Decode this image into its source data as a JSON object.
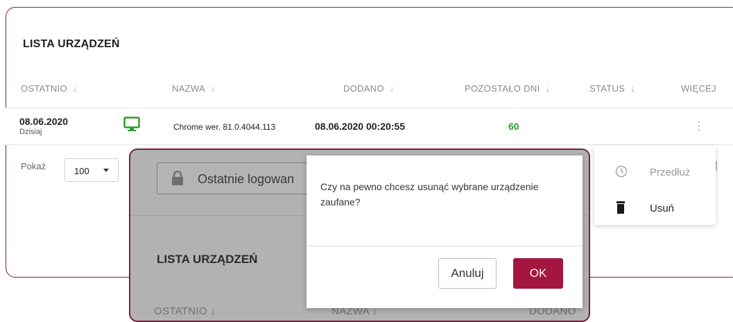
{
  "section": {
    "title": "LISTA URZĄDZEŃ"
  },
  "table": {
    "columns": [
      "OSTATNIO",
      "NAZWA",
      "DODANO",
      "POZOSTAŁO DNI",
      "STATUS",
      "WIĘCEJ"
    ],
    "rows": [
      {
        "last_date": "08.06.2020",
        "last_sub": "Dzisiaj",
        "device_icon": "monitor-icon",
        "name": "Chrome wer. 81.0.4044.113",
        "added": "08.06.2020 00:20:55",
        "days_left": "60",
        "status": ""
      }
    ]
  },
  "pagination": {
    "label": "Pokaż",
    "value": "100"
  },
  "context_menu": {
    "items": [
      {
        "label": "Przedłuż",
        "icon": "clock-icon"
      },
      {
        "label": "Usuń",
        "icon": "trash-icon"
      }
    ]
  },
  "overlay": {
    "login_button": "Ostatnie logowan",
    "title": "LISTA URZĄDZEŃ",
    "columns": [
      "OSTATNIO",
      "NAZWA",
      "DODANO"
    ]
  },
  "dialog": {
    "message": "Czy na pewno chcesz usunąć wybrane urządzenie zaufane?",
    "cancel": "Anuluj",
    "ok": "OK"
  },
  "colors": {
    "accent": "#a3163f",
    "positive": "#2e9b2e",
    "border": "#8a1c44"
  }
}
